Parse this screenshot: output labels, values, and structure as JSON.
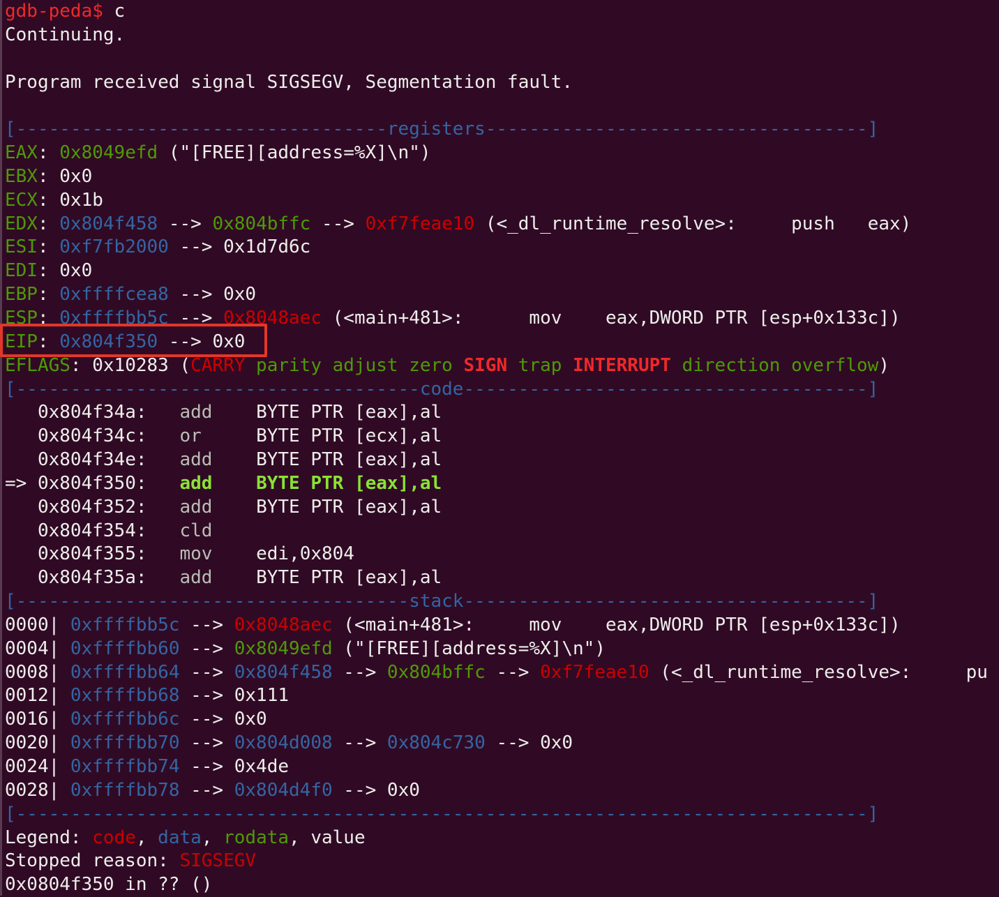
{
  "terminal": {
    "prompt": "gdb-peda$",
    "command": " c",
    "continuing": "Continuing.",
    "signal_msg": "Program received signal SIGSEGV, Segmentation fault."
  },
  "registers": {
    "header_left": "[----------------------------------",
    "header_title": "registers",
    "header_right": "-----------------------------------]",
    "eax": {
      "name": "EAX",
      "value": "0x8049efd",
      "rest": " (\"[FREE][address=%X]\\n\")"
    },
    "ebx": {
      "name": "EBX",
      "value": "0x0"
    },
    "ecx": {
      "name": "ECX",
      "value": "0x1b"
    },
    "edx": {
      "name": "EDX",
      "value": "0x804f458",
      "arrow1": " --> ",
      "v2": "0x804bffc",
      "arrow2": " --> ",
      "v3": "0xf7feae10",
      "rest": " (<_dl_runtime_resolve>:     push   eax)"
    },
    "esi": {
      "name": "ESI",
      "value": "0xf7fb2000",
      "arrow": " --> ",
      "v2": "0x1d7d6c"
    },
    "edi": {
      "name": "EDI",
      "value": "0x0"
    },
    "ebp": {
      "name": "EBP",
      "value": "0xffffcea8",
      "arrow": " --> ",
      "v2": "0x0"
    },
    "esp": {
      "name": "ESP",
      "value": "0xffffbb5c",
      "arrow": " --> ",
      "v2": "0x8048aec",
      "rest": " (<main+481>:      mov    eax,DWORD PTR [esp+0x133c])"
    },
    "eip": {
      "name": "EIP",
      "value": "0x804f350",
      "arrow": " --> ",
      "v2": "0x0"
    },
    "eflags": {
      "name": "EFLAGS",
      "value": "0x10283",
      "open": " (",
      "carry": "CARRY",
      "parity_adjust_zero": " parity adjust zero ",
      "sign": "SIGN",
      "trap": " trap ",
      "interrupt": "INTERRUPT",
      "dir_over": " direction overflow",
      "close": ")"
    }
  },
  "code": {
    "header_left": "[-------------------------------------",
    "header_title": "code",
    "header_right": "-------------------------------------]",
    "lines": [
      {
        "prefix": "   ",
        "addr": "0x804f34a:",
        "gap": "   ",
        "op": "add",
        "pad": "    ",
        "args": "BYTE PTR [eax],al",
        "current": false
      },
      {
        "prefix": "   ",
        "addr": "0x804f34c:",
        "gap": "   ",
        "op": "or ",
        "pad": "    ",
        "args": "BYTE PTR [ecx],al",
        "current": false
      },
      {
        "prefix": "   ",
        "addr": "0x804f34e:",
        "gap": "   ",
        "op": "add",
        "pad": "    ",
        "args": "BYTE PTR [eax],al",
        "current": false
      },
      {
        "prefix": "=> ",
        "addr": "0x804f350:",
        "gap": "   ",
        "op": "add",
        "pad": "    ",
        "args": "BYTE PTR [eax],al",
        "current": true
      },
      {
        "prefix": "   ",
        "addr": "0x804f352:",
        "gap": "   ",
        "op": "add",
        "pad": "    ",
        "args": "BYTE PTR [eax],al",
        "current": false
      },
      {
        "prefix": "   ",
        "addr": "0x804f354:",
        "gap": "   ",
        "op": "cld",
        "pad": "",
        "args": "",
        "current": false
      },
      {
        "prefix": "   ",
        "addr": "0x804f355:",
        "gap": "   ",
        "op": "mov",
        "pad": "    ",
        "args": "edi,0x804",
        "current": false
      },
      {
        "prefix": "   ",
        "addr": "0x804f35a:",
        "gap": "   ",
        "op": "add",
        "pad": "    ",
        "args": "BYTE PTR [eax],al",
        "current": false
      }
    ]
  },
  "stack": {
    "header_left": "[------------------------------------",
    "header_title": "stack",
    "header_right": "-------------------------------------]",
    "rows": [
      {
        "off": "0000|",
        "addr": " 0xffffbb5c",
        "a1": " --> ",
        "v1": "0x8048aec",
        "v1c": "red",
        "rest": " (<main+481>:     mov    eax,DWORD PTR [esp+0x133c])"
      },
      {
        "off": "0004|",
        "addr": " 0xffffbb60",
        "a1": " --> ",
        "v1": "0x8049efd",
        "v1c": "green",
        "rest": " (\"[FREE][address=%X]\\n\")"
      },
      {
        "off": "0008|",
        "addr": " 0xffffbb64",
        "a1": " --> ",
        "v1": "0x804f458",
        "v1c": "blue",
        "a2": " --> ",
        "v2": "0x804bffc",
        "v2c": "green",
        "a3": " --> ",
        "v3": "0xf7feae10",
        "v3c": "red",
        "rest": " (<_dl_runtime_resolve>:     pu"
      },
      {
        "off": "0012|",
        "addr": " 0xffffbb68",
        "a1": " --> ",
        "v1": "0x111",
        "v1c": "plain"
      },
      {
        "off": "0016|",
        "addr": " 0xffffbb6c",
        "a1": " --> ",
        "v1": "0x0",
        "v1c": "plain"
      },
      {
        "off": "0020|",
        "addr": " 0xffffbb70",
        "a1": " --> ",
        "v1": "0x804d008",
        "v1c": "blue",
        "a2": " --> ",
        "v2": "0x804c730",
        "v2c": "blue",
        "a3": " --> ",
        "v3": "0x0",
        "v3c": "plain"
      },
      {
        "off": "0024|",
        "addr": " 0xffffbb74",
        "a1": " --> ",
        "v1": "0x4de",
        "v1c": "plain"
      },
      {
        "off": "0028|",
        "addr": " 0xffffbb78",
        "a1": " --> ",
        "v1": "0x804d4f0",
        "v1c": "blue",
        "a2": " --> ",
        "v2": "0x0",
        "v2c": "plain"
      }
    ],
    "footer": "[------------------------------------------------------------------------------]"
  },
  "legend": {
    "label": "Legend: ",
    "code": "code",
    "sep1": ", ",
    "data": "data",
    "sep2": ", ",
    "rodata": "rodata",
    "sep3": ", ",
    "value": "value"
  },
  "stopped": {
    "label": "Stopped reason: ",
    "reason": "SIGSEGV"
  },
  "location": "0x0804f350 in ?? ()",
  "colors": {
    "background": "#300a24",
    "highlight_box": "#e1372b"
  }
}
